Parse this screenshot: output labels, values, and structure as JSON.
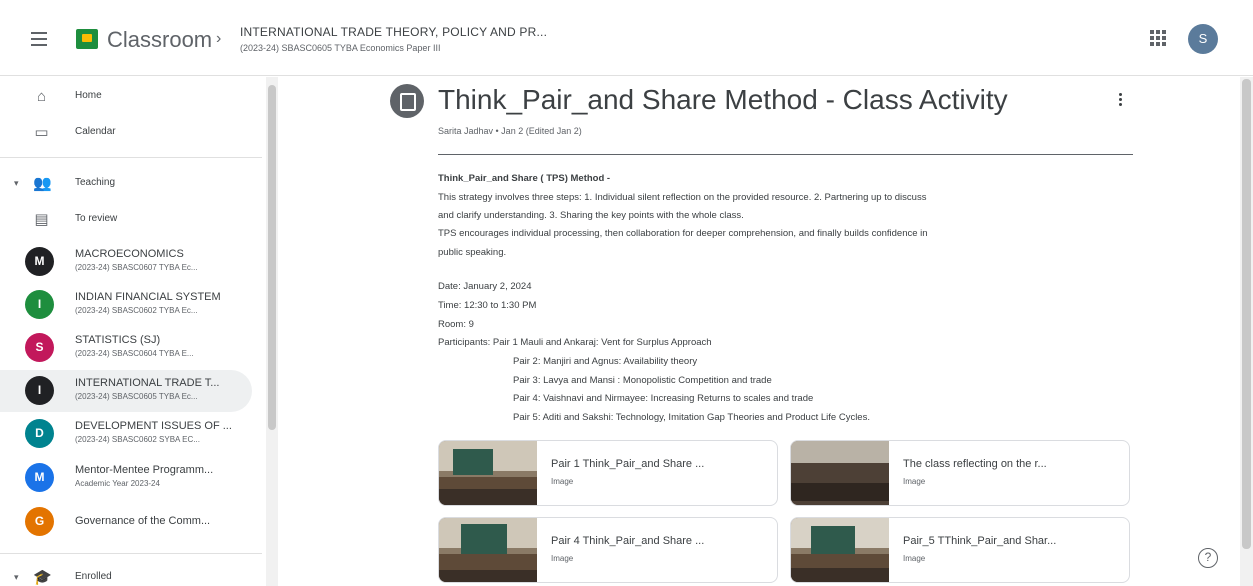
{
  "header": {
    "app_title": "Classroom",
    "breadcrumb_chevron": "›",
    "breadcrumb_title": "INTERNATIONAL TRADE THEORY, POLICY AND PR...",
    "breadcrumb_subtitle": "(2023-24) SBASC0605 TYBA Economics Paper III",
    "user_initial": "S",
    "icons": [
      "menu-icon",
      "classroom-logo",
      "apps-grid-icon",
      "avatar"
    ]
  },
  "sidebar": {
    "home_label": "Home",
    "calendar_label": "Calendar",
    "teaching_label": "Teaching",
    "to_review_label": "To review",
    "enrolled_label": "Enrolled",
    "classes": [
      {
        "initial": "M",
        "name": "MACROECONOMICS",
        "sub": "(2023-24) SBASC0607 TYBA Ec...",
        "color": "#202124"
      },
      {
        "initial": "I",
        "name": "INDIAN FINANCIAL SYSTEM",
        "sub": "(2023-24) SBASC0602 TYBA Ec...",
        "color": "#1e8e3e"
      },
      {
        "initial": "S",
        "name": "STATISTICS (SJ)",
        "sub": "(2023-24) SBASC0604 TYBA E...",
        "color": "#c2185b"
      },
      {
        "initial": "I",
        "name": "INTERNATIONAL TRADE T...",
        "sub": "(2023-24) SBASC0605 TYBA Ec...",
        "color": "#202124"
      },
      {
        "initial": "D",
        "name": "DEVELOPMENT ISSUES OF ...",
        "sub": "(2023-24) SBASC0602 SYBA EC...",
        "color": "#00838f"
      },
      {
        "initial": "M",
        "name": "Mentor-Mentee Programm...",
        "sub": "Academic Year 2023-24",
        "color": "#1a73e8"
      },
      {
        "initial": "G",
        "name": "Governance of the Comm...",
        "sub": "",
        "color": "#e37400"
      }
    ]
  },
  "post": {
    "title": "Think_Pair_and Share Method - Class Activity",
    "meta": "Sarita Jadhav • Jan 2 (Edited Jan 2)",
    "heading": "Think_Pair_and Share ( TPS)  Method -",
    "p1_line1": "This strategy involves three steps: 1. Individual silent reflection on the provided resource. 2. Partnering up to discuss",
    "p1_line2": "and clarify understanding. 3. Sharing the key points with the whole class.",
    "p2_line1": "TPS encourages individual processing, then collaboration for deeper comprehension, and finally builds confidence in",
    "p2_line2": "public speaking.",
    "date": "Date: January 2, 2024",
    "time": "Time: 12:30 to 1:30 PM",
    "room": "Room: 9",
    "participants": [
      "Participants: Pair 1 Mauli and Ankaraj: Vent for Surplus Approach",
      "Pair 2:  Manjiri and Agnus: Availability theory",
      "Pair 3: Lavya and Mansi : Monopolistic Competition and trade",
      "Pair 4: Vaishnavi and Nirmayee: Increasing Returns to scales and trade",
      "Pair 5: Aditi and Sakshi: Technology, Imitation Gap Theories and Product Life Cycles."
    ],
    "attachments": [
      {
        "name": "Pair 1 Think_Pair_and Share ...",
        "type": "Image"
      },
      {
        "name": "The class reflecting on the r...",
        "type": "Image"
      },
      {
        "name": "Pair 4 Think_Pair_and Share ...",
        "type": "Image"
      },
      {
        "name": "Pair_5 TThink_Pair_and Shar...",
        "type": "Image"
      }
    ]
  },
  "help_label": "?"
}
